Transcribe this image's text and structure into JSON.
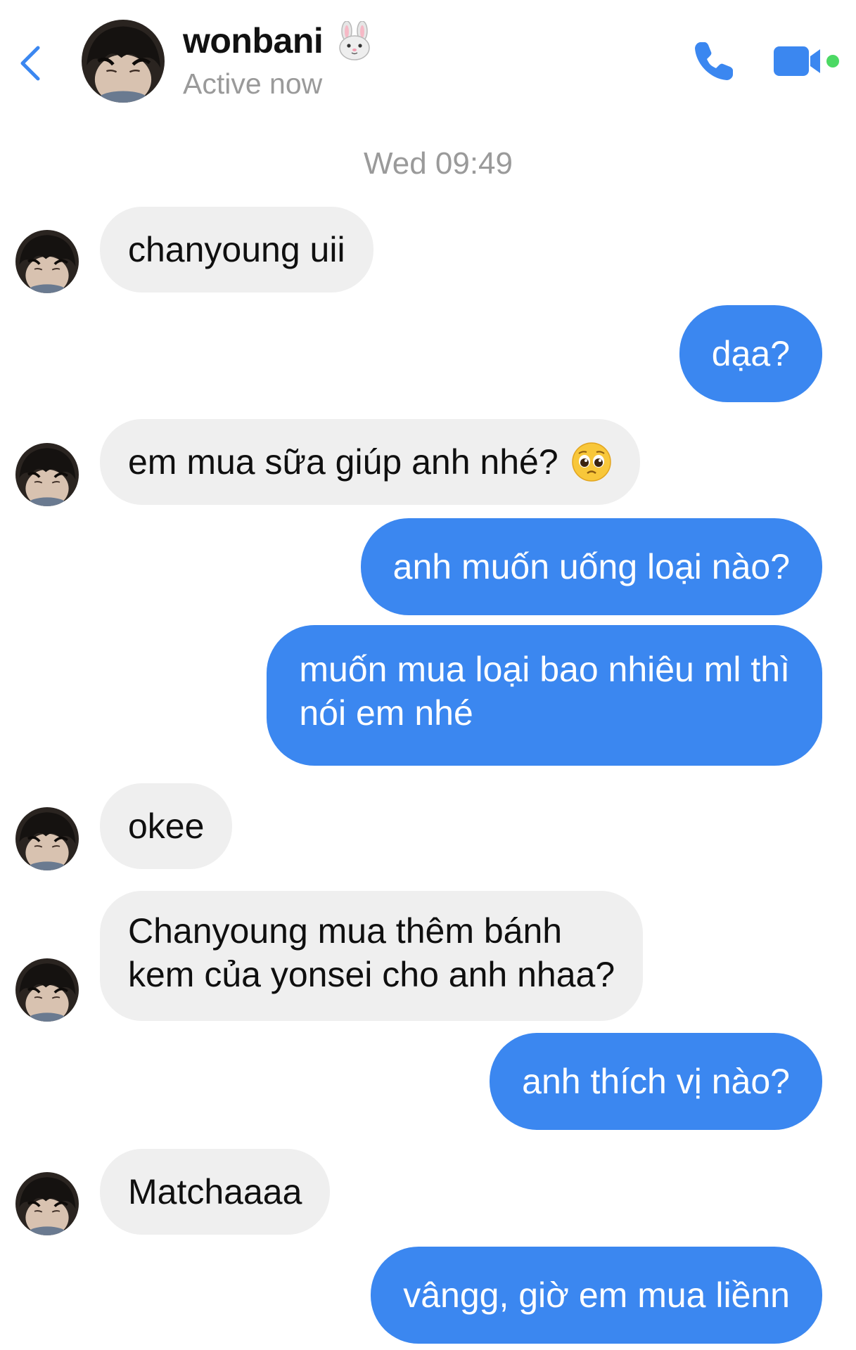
{
  "header": {
    "contact_name": "wonbani",
    "name_emoji_icon": "rabbit-face-icon",
    "status": "Active now",
    "back_icon": "chevron-left-icon",
    "call_icon": "phone-icon",
    "video_icon": "video-camera-icon",
    "active_dot_color": "#4cd964"
  },
  "thread": {
    "timestamp": "Wed 09:49",
    "messages": [
      {
        "from": "them",
        "text": "chanyoung uii"
      },
      {
        "from": "me",
        "text": "dạa?"
      },
      {
        "from": "them",
        "text": "em mua sữa giúp anh nhé?",
        "emoji_icon": "pleading-face-icon"
      },
      {
        "from": "me",
        "text": "anh muốn uống loại nào?"
      },
      {
        "from": "me",
        "lines": [
          "muốn mua loại bao nhiêu ml thì",
          "nói em nhé"
        ]
      },
      {
        "from": "them",
        "text": "okee"
      },
      {
        "from": "them",
        "lines": [
          "Chanyoung mua thêm bánh",
          "kem của yonsei cho anh nhaa?"
        ]
      },
      {
        "from": "me",
        "text": "anh thích vị nào?"
      },
      {
        "from": "them",
        "text": "Matchaaaa"
      },
      {
        "from": "me",
        "text": "vângg, giờ em mua liềnn"
      }
    ]
  },
  "colors": {
    "accent": "#3b87f0",
    "incoming_bubble": "#efefef",
    "secondary_text": "#9a9a9a"
  }
}
